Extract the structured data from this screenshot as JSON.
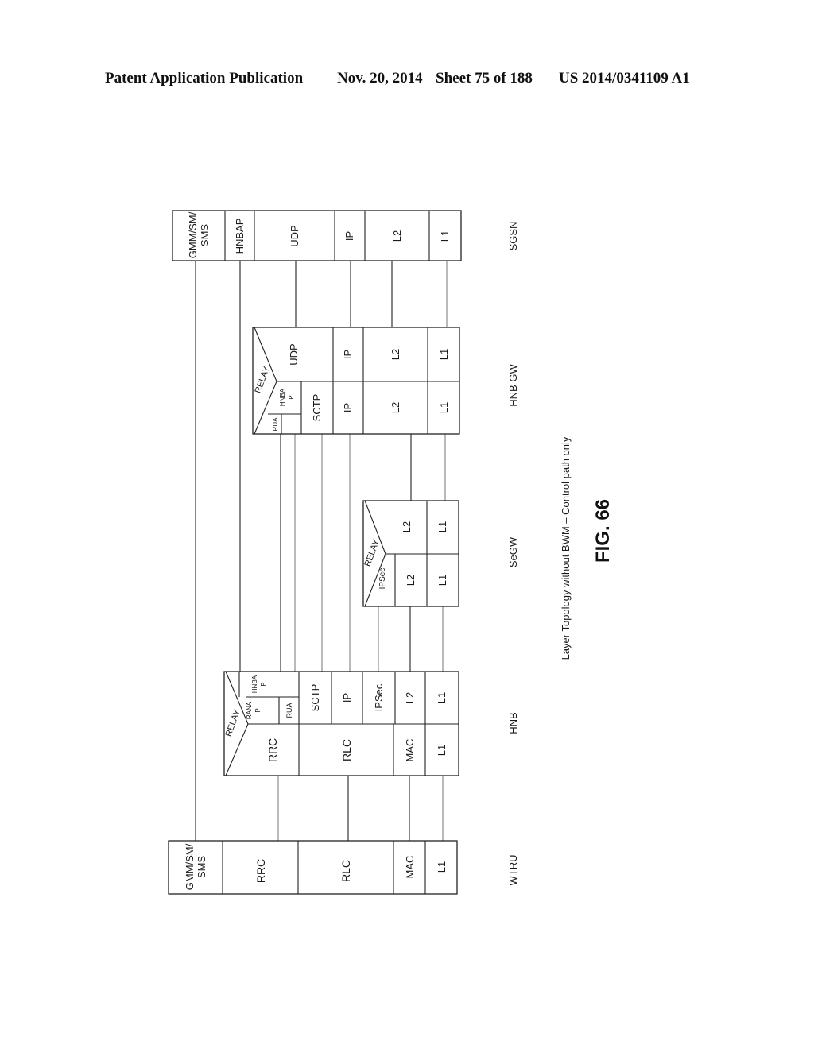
{
  "header": {
    "publication": "Patent Application Publication",
    "date": "Nov. 20, 2014",
    "sheet": "Sheet 75 of 188",
    "number": "US 2014/0341109 A1"
  },
  "figure": {
    "caption": "Layer Topology without BWM – Control path only",
    "label": "FIG. 66"
  },
  "nodes": {
    "wtru": {
      "name": "WTRU",
      "layers": [
        "GMM/SM/",
        "SMS",
        "RRC",
        "RLC",
        "MAC",
        "L1"
      ]
    },
    "hnb": {
      "name": "HNB",
      "relay": "RELAY",
      "radio_side": [
        "RRC",
        "RLC",
        "MAC",
        "L1"
      ],
      "network_side": [
        "HNBA",
        "P",
        "RANA",
        "P",
        "RUA",
        "SCTP",
        "IP",
        "IPSec",
        "L2",
        "L1"
      ]
    },
    "segw": {
      "name": "SeGW",
      "relay": "RELAY",
      "left_side": [
        "IPSec",
        "L2",
        "L1"
      ],
      "right_side": [
        "L2",
        "L1"
      ]
    },
    "hnbgw": {
      "name": "HNB GW",
      "relay": "RELAY",
      "left_side": [
        "RUA",
        "HNBA",
        "P",
        "SCTP",
        "IP",
        "L2",
        "L1"
      ],
      "right_side": [
        "UDP",
        "IP",
        "L2",
        "L1"
      ]
    },
    "sgsn": {
      "name": "SGSN",
      "layers": [
        "GMM/SM/",
        "SMS",
        "HNBAP",
        "UDP",
        "IP",
        "L2",
        "L1"
      ]
    }
  }
}
